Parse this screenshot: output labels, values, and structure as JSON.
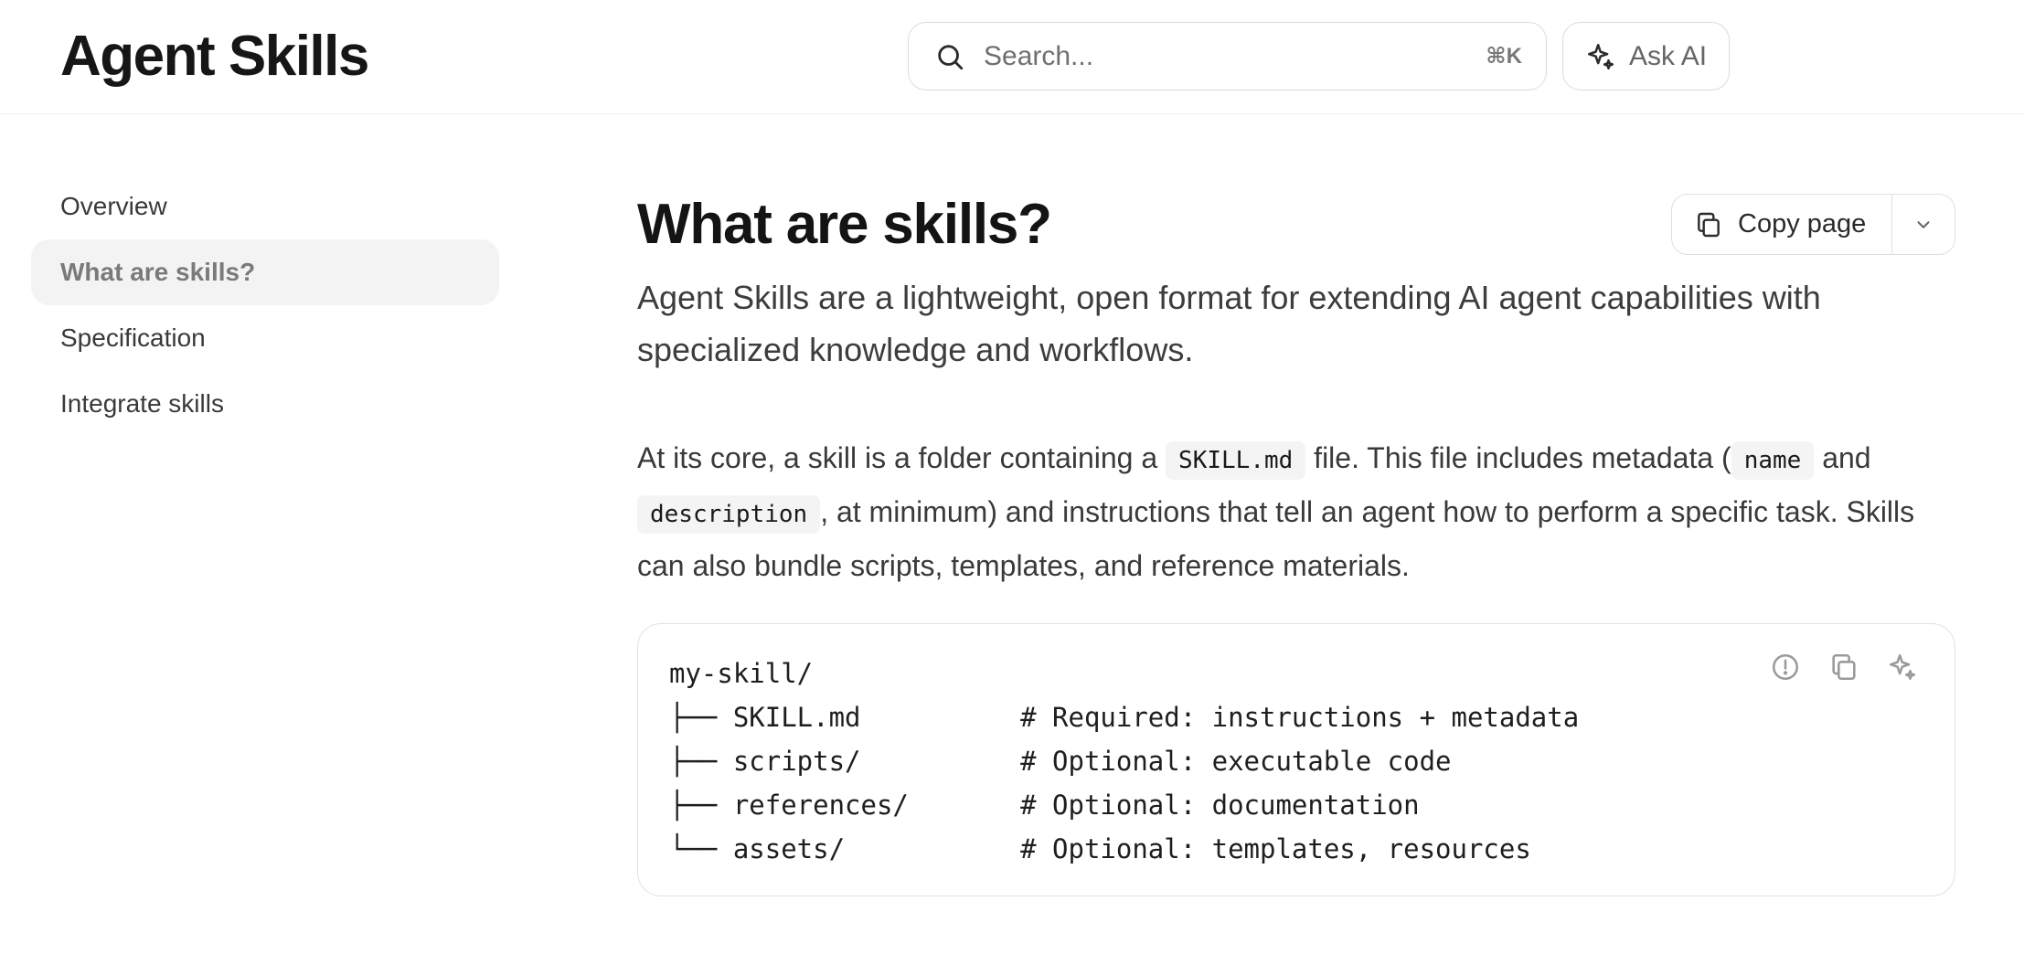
{
  "header": {
    "brand": "Agent Skills",
    "search_placeholder": "Search...",
    "search_shortcut": "⌘K",
    "ask_ai_label": "Ask AI"
  },
  "sidebar": {
    "items": [
      {
        "label": "Overview",
        "active": false
      },
      {
        "label": "What are skills?",
        "active": true
      },
      {
        "label": "Specification",
        "active": false
      },
      {
        "label": "Integrate skills",
        "active": false
      }
    ]
  },
  "main": {
    "title": "What are skills?",
    "copy_page_label": "Copy page",
    "lead": "Agent Skills are a lightweight, open format for extending AI agent capabilities with specialized knowledge and workflows.",
    "para": {
      "t1": "At its core, a skill is a folder containing a ",
      "c1": "SKILL.md",
      "t2": " file. This file includes metadata (",
      "c2": "name",
      "t3": " and ",
      "c3": "description",
      "t4": ", at minimum) and instructions that tell an agent how to perform a specific task. Skills can also bundle scripts, templates, and reference materials."
    },
    "code_lines": [
      "my-skill/",
      "├── SKILL.md          # Required: instructions + metadata",
      "├── scripts/          # Optional: executable code",
      "├── references/       # Optional: documentation",
      "└── assets/           # Optional: templates, resources"
    ]
  }
}
